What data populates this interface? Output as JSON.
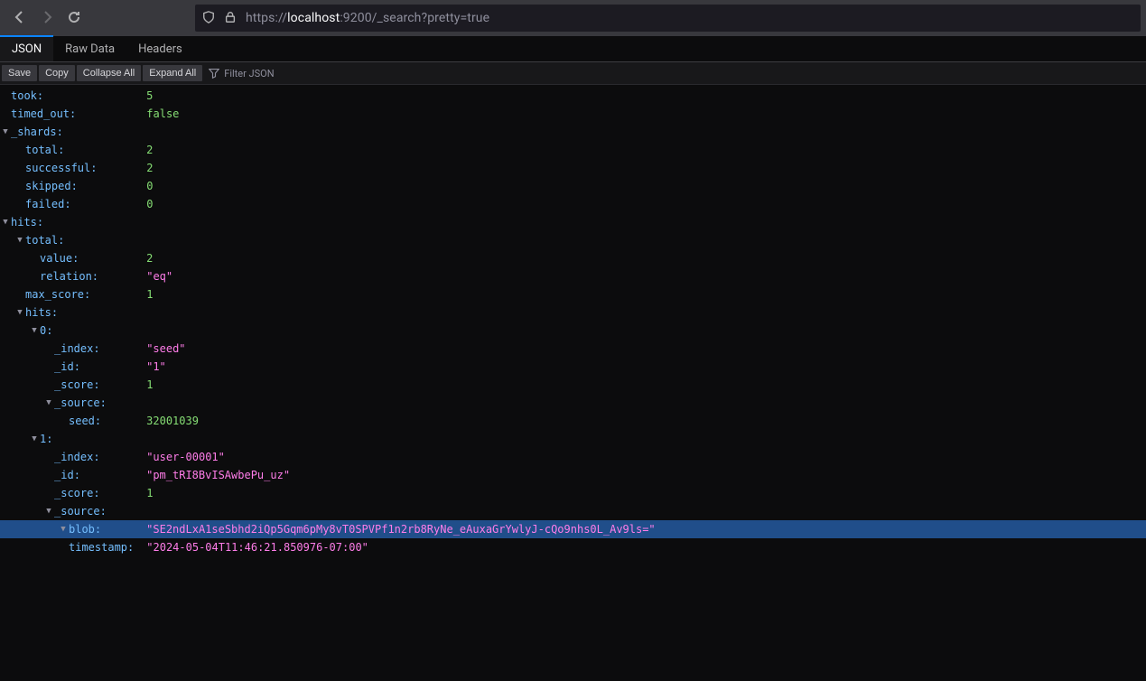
{
  "url": {
    "scheme": "https://",
    "host": "localhost",
    "rest": ":9200/_search?pretty=true"
  },
  "tabs": {
    "json": "JSON",
    "raw": "Raw Data",
    "headers": "Headers"
  },
  "toolbar": {
    "save": "Save",
    "copy": "Copy",
    "collapse": "Collapse All",
    "expand": "Expand All",
    "filter_placeholder": "Filter JSON"
  },
  "tree": [
    {
      "indent": 0,
      "tw": "",
      "key": "took",
      "vtype": "num",
      "val": "5"
    },
    {
      "indent": 0,
      "tw": "",
      "key": "timed_out",
      "vtype": "bool",
      "val": "false"
    },
    {
      "indent": 0,
      "tw": "▼",
      "key": "_shards",
      "vtype": "",
      "val": "",
      "twpos": -1
    },
    {
      "indent": 1,
      "tw": "",
      "key": "total",
      "vtype": "num",
      "val": "2"
    },
    {
      "indent": 1,
      "tw": "",
      "key": "successful",
      "vtype": "num",
      "val": "2"
    },
    {
      "indent": 1,
      "tw": "",
      "key": "skipped",
      "vtype": "num",
      "val": "0"
    },
    {
      "indent": 1,
      "tw": "",
      "key": "failed",
      "vtype": "num",
      "val": "0"
    },
    {
      "indent": 0,
      "tw": "▼",
      "key": "hits",
      "vtype": "",
      "val": "",
      "twpos": -1
    },
    {
      "indent": 1,
      "tw": "▼",
      "key": "total",
      "vtype": "",
      "val": ""
    },
    {
      "indent": 2,
      "tw": "",
      "key": "value",
      "vtype": "num",
      "val": "2"
    },
    {
      "indent": 2,
      "tw": "",
      "key": "relation",
      "vtype": "str",
      "val": "\"eq\""
    },
    {
      "indent": 1,
      "tw": "",
      "key": "max_score",
      "vtype": "num",
      "val": "1"
    },
    {
      "indent": 1,
      "tw": "▼",
      "key": "hits",
      "vtype": "",
      "val": ""
    },
    {
      "indent": 2,
      "tw": "▼",
      "key": "0",
      "vtype": "",
      "val": ""
    },
    {
      "indent": 3,
      "tw": "",
      "key": "_index",
      "vtype": "str",
      "val": "\"seed\""
    },
    {
      "indent": 3,
      "tw": "",
      "key": "_id",
      "vtype": "str",
      "val": "\"1\""
    },
    {
      "indent": 3,
      "tw": "",
      "key": "_score",
      "vtype": "num",
      "val": "1"
    },
    {
      "indent": 3,
      "tw": "▼",
      "key": "_source",
      "vtype": "",
      "val": ""
    },
    {
      "indent": 4,
      "tw": "",
      "key": "seed",
      "vtype": "num",
      "val": "32001039"
    },
    {
      "indent": 2,
      "tw": "▼",
      "key": "1",
      "vtype": "",
      "val": ""
    },
    {
      "indent": 3,
      "tw": "",
      "key": "_index",
      "vtype": "str",
      "val": "\"user-00001\""
    },
    {
      "indent": 3,
      "tw": "",
      "key": "_id",
      "vtype": "str",
      "val": "\"pm_tRI8BvISAwbePu_uz\""
    },
    {
      "indent": 3,
      "tw": "",
      "key": "_score",
      "vtype": "num",
      "val": "1"
    },
    {
      "indent": 3,
      "tw": "▼",
      "key": "_source",
      "vtype": "",
      "val": ""
    },
    {
      "indent": 4,
      "tw": "▼",
      "key": "blob",
      "vtype": "str",
      "val": "\"SE2ndLxA1seSbhd2iQp5Gqm6pMy8vT0SPVPf1n2rb8RyNe_eAuxaGrYwlyJ-cQo9nhs0L_Av9ls=\"",
      "selected": true
    },
    {
      "indent": 4,
      "tw": "",
      "key": "timestamp",
      "vtype": "str",
      "val": "\"2024-05-04T11:46:21.850976-07:00\""
    }
  ]
}
